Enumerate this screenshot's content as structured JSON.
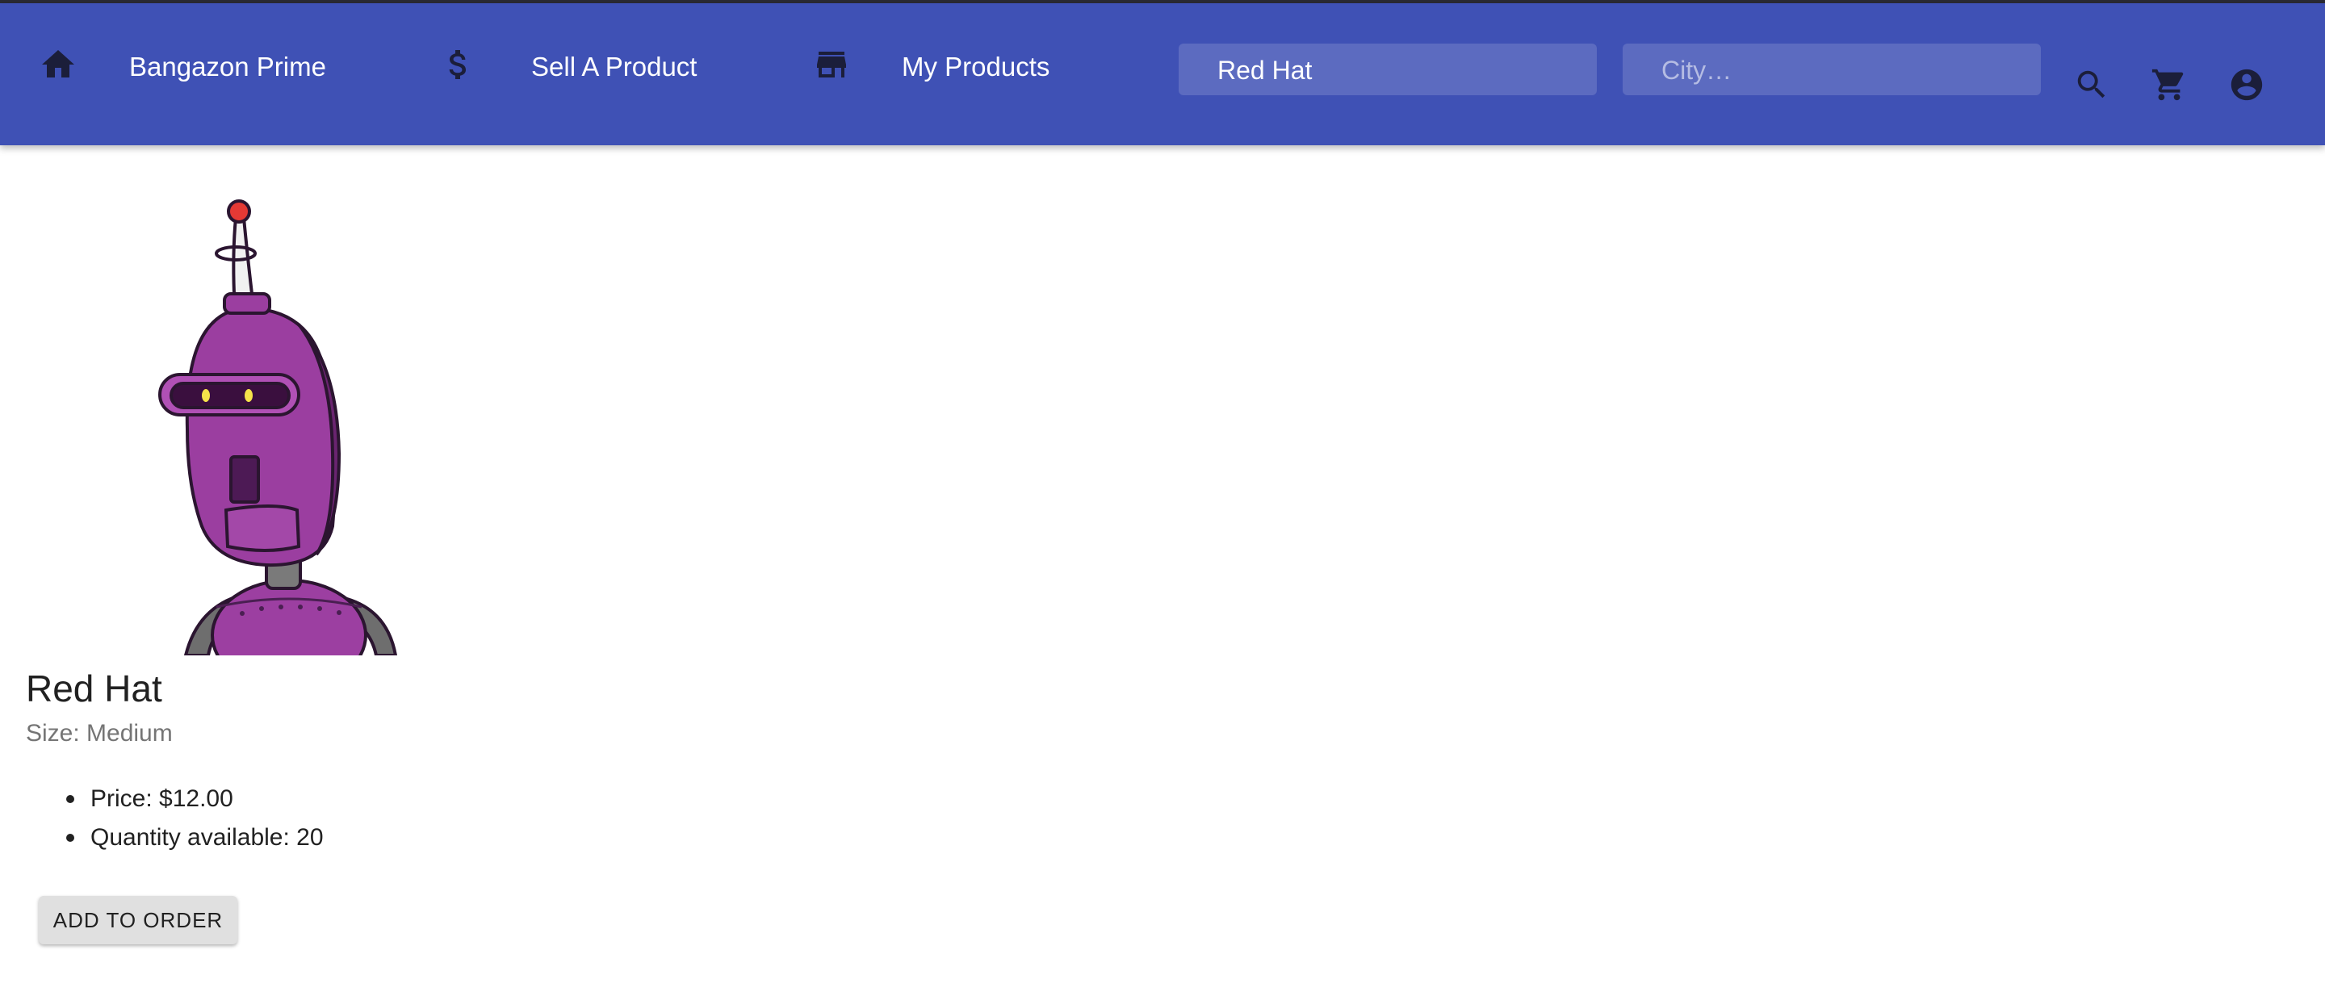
{
  "nav": {
    "home_label": "Bangazon Prime",
    "sell_label": "Sell A Product",
    "my_products_label": "My Products",
    "icons": {
      "home": "home-icon",
      "sell": "dollar-icon",
      "my_products": "store-icon"
    }
  },
  "search": {
    "query_value": "Red Hat",
    "city_placeholder": "City…"
  },
  "actions": {
    "search_icon": "search-icon",
    "cart_icon": "cart-icon",
    "account_icon": "account-circle-icon"
  },
  "product": {
    "title": "Red Hat",
    "size": "Size: Medium",
    "price": "Price: $12.00",
    "quantity": "Quantity available: 20",
    "add_button_label": "ADD TO ORDER"
  },
  "colors": {
    "appbar": "#3f51b5",
    "search_field": "#5c6bc0",
    "icon": "#1b1e3a",
    "button": "#e0e0e0"
  }
}
